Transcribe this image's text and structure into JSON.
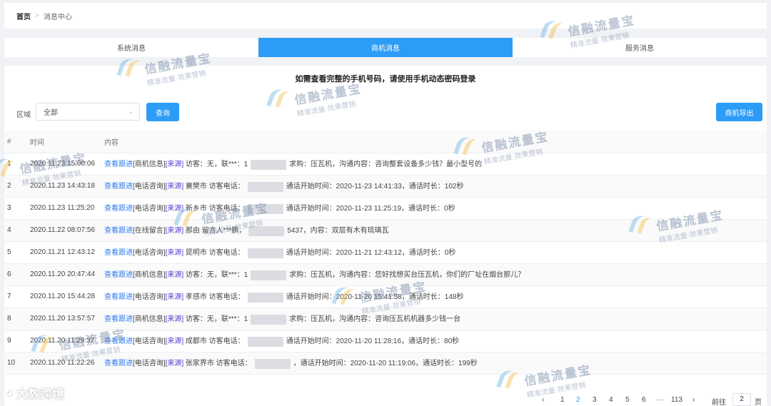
{
  "breadcrumb": {
    "home": "首页",
    "separator": ">",
    "current": "消息中心"
  },
  "tabs": [
    {
      "label": "系统消息",
      "active": false
    },
    {
      "label": "商机消息",
      "active": true
    },
    {
      "label": "服务消息",
      "active": false
    }
  ],
  "notice": "如需查看完整的手机号码，请使用手机动态密码登录",
  "filter": {
    "label": "区域",
    "selected": "全部",
    "query_label": "查询",
    "export_label": "商机导出"
  },
  "table": {
    "headers": [
      "#",
      "时间",
      "内容"
    ],
    "follow_label": "查看跟进",
    "source_label": "[来源]",
    "rows": [
      {
        "idx": "1",
        "time": "2020.11.23 15:00:06",
        "type": "[商机信息]",
        "pre": "访客：无，联***：1",
        "post": "求购：压瓦机，沟通内容：咨询整套设备多少钱？最小型号的"
      },
      {
        "idx": "2",
        "time": "2020.11.23 14:43:18",
        "type": "[电话咨询]",
        "pre": "襄樊市 访客电话：",
        "post": "通话开始时间：2020-11-23 14:41:33，通话时长：102秒"
      },
      {
        "idx": "3",
        "time": "2020.11.23 11:25:20",
        "type": "[电话咨询]",
        "pre": "新乡市 访客电话：",
        "post": "通话开始时间：2020-11-23 11:25:19，通话时长：0秒"
      },
      {
        "idx": "4",
        "time": "2020.11.22 08:07:56",
        "type": "[在线留言]",
        "pre": "那由 留言人***鹏，",
        "post": "5437，内容：双层有木有琉璃瓦"
      },
      {
        "idx": "5",
        "time": "2020.11.21 12:43:12",
        "type": "[电话咨询]",
        "pre": "昆明市 访客电话：",
        "post": "通话开始时间：2020-11-21 12:43:12，通话时长：0秒"
      },
      {
        "idx": "6",
        "time": "2020.11.20 20:47:44",
        "type": "[商机信息]",
        "pre": "访客：无，联***：1",
        "post": "求购：压瓦机，沟通内容：您好找想买台压瓦机，你们的厂址在烟台那儿？"
      },
      {
        "idx": "7",
        "time": "2020.11.20 15:44:28",
        "type": "[电话咨询]",
        "pre": "孝感市 访客电话：",
        "post": "通话开始时间：2020-11-20 15:41:58，通话时长：148秒"
      },
      {
        "idx": "8",
        "time": "2020.11.20 13:57:57",
        "type": "[商机信息]",
        "pre": "访客：无，联***：1",
        "post": "求购：压瓦机，沟通内容：咨询压瓦机机器多少钱一台"
      },
      {
        "idx": "9",
        "time": "2020.11.20 11:29:37",
        "type": "[电话咨询]",
        "pre": "成都市 访客电话：",
        "post": "通话开始时间：2020-11-20 11:28:16，通话时长：80秒"
      },
      {
        "idx": "10",
        "time": "2020.11.20 11:22:26",
        "type": "[电话咨询]",
        "pre": "张家界市 访客电话：",
        "post": "，通话开始时间：2020-11-20 11:19:06，通话时长：199秒"
      }
    ]
  },
  "pagination": {
    "prev": "‹",
    "pages": [
      "1",
      "2",
      "3",
      "4",
      "5",
      "6",
      "···",
      "113"
    ],
    "current": "2",
    "next": "›",
    "goto_prefix": "前往",
    "goto_value": "2",
    "goto_suffix": "页"
  },
  "watermark": {
    "title": "信融流量宝",
    "slogan": "精准流量·效果营销"
  },
  "brand": "大数跨境"
}
